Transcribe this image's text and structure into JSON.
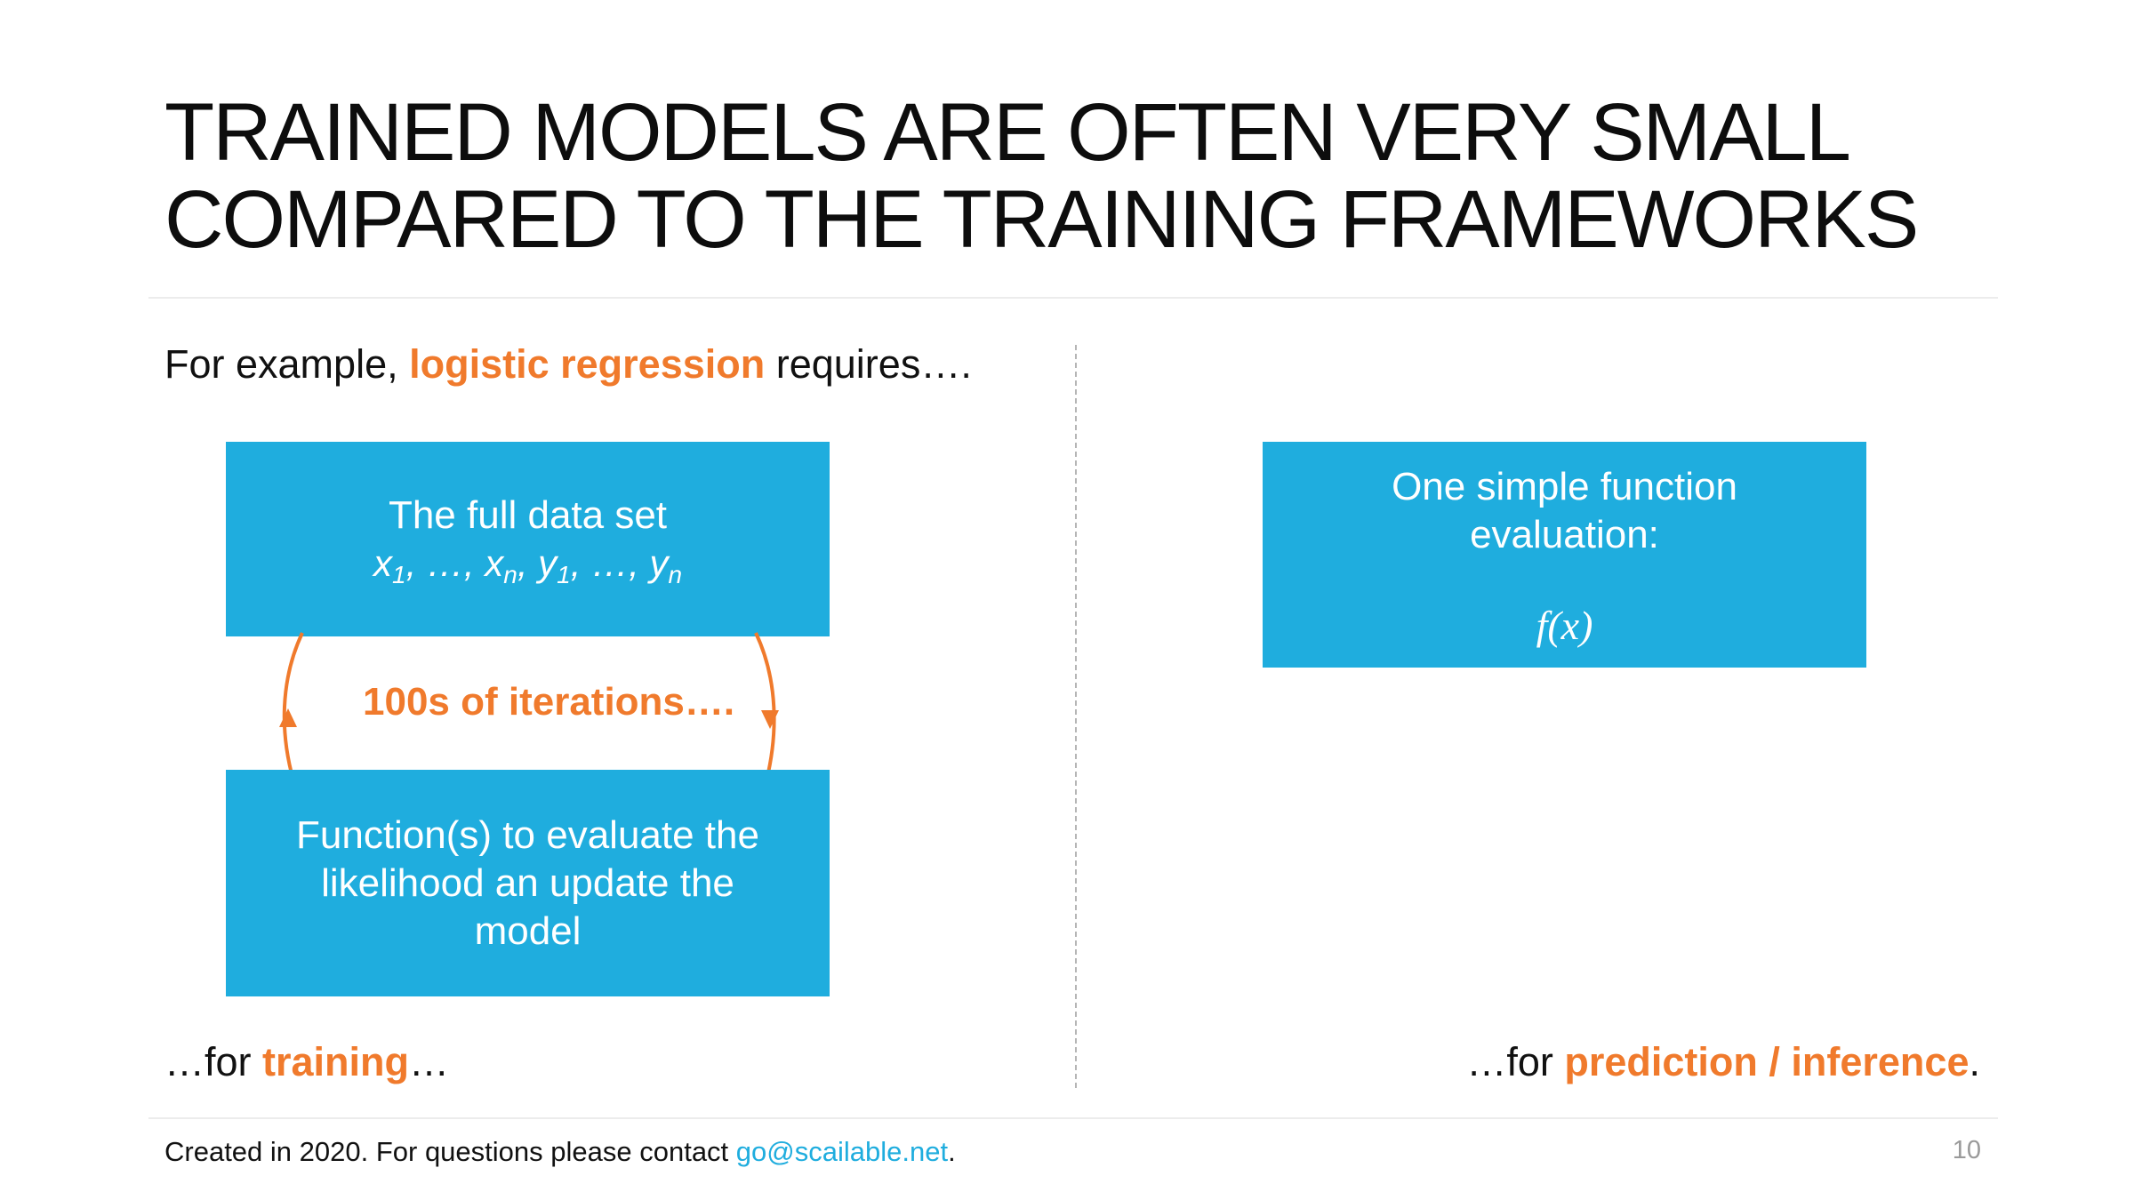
{
  "slide": {
    "title_line1": "TRAINED MODELS ARE OFTEN VERY SMALL",
    "title_line2": "COMPARED TO THE TRAINING FRAMEWORKS",
    "intro_prefix": "For example, ",
    "intro_highlight": "logistic regression",
    "intro_suffix": " requires…."
  },
  "left": {
    "data_box_line1": "The full data set",
    "data_box_math": {
      "x": "x",
      "x_sub1": "1",
      "sep1": ", …, ",
      "xn": "x",
      "x_subn": "n",
      "sep2": ", ",
      "y": "y",
      "y_sub1": "1",
      "sep3": ", …, ",
      "yn": "y",
      "y_subn": "n"
    },
    "iterations_label": "100s of iterations….",
    "function_box_line1": "Function(s) to evaluate the",
    "function_box_line2": "likelihood an update the",
    "function_box_line3": "model",
    "caption_prefix": "…for ",
    "caption_highlight": "training",
    "caption_suffix": "…"
  },
  "right": {
    "eval_box_line1": "One simple function",
    "eval_box_line2": "evaluation:",
    "eval_box_formula": "f(x)",
    "caption_prefix": "…for ",
    "caption_highlight": "prediction / inference",
    "caption_suffix": "."
  },
  "footer": {
    "text": "Created in 2020. For questions please contact ",
    "email": "go@scailable.net",
    "end": ".",
    "page_number": "10"
  },
  "colors": {
    "accent": "#f07a2c",
    "box": "#1fadde",
    "link": "#1fadde"
  }
}
